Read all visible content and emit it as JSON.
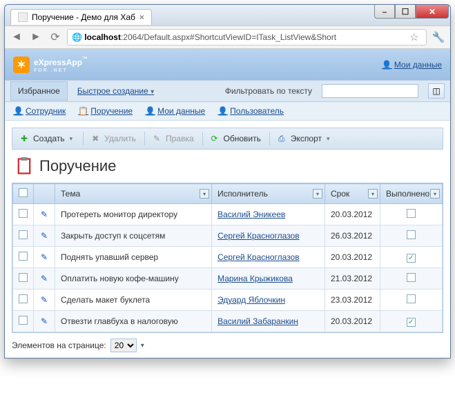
{
  "browser": {
    "tab_title": "Поручение - Демо для Хаб",
    "url_prefix": "localhost",
    "url_rest": ":2064/Default.aspx#ShortcutViewID=ITask_ListView&Short"
  },
  "header": {
    "logo_main": "eXpressApp",
    "logo_sub": "FOR .NET",
    "user_link": "Мои данные"
  },
  "menubar": {
    "favorites": "Избранное",
    "quick_create": "Быстрое создание",
    "filter_label": "Фильтровать по тексту"
  },
  "subnav": {
    "employee": "Сотрудник",
    "task": "Поручение",
    "mydata": "Мои данные",
    "user": "Пользователь"
  },
  "toolbar": {
    "create": "Создать",
    "delete": "Удалить",
    "edit": "Правка",
    "refresh": "Обновить",
    "export": "Экспорт"
  },
  "page": {
    "title": "Поручение"
  },
  "grid": {
    "columns": {
      "subject": "Тема",
      "assignee": "Исполнитель",
      "due": "Срок",
      "done": "Выполнено"
    },
    "rows": [
      {
        "subject": "Протереть монитор директору",
        "assignee": "Василий Эникеев",
        "due": "20.03.2012",
        "done": false
      },
      {
        "subject": "Закрыть доступ к соцсетям",
        "assignee": "Сергей Красноглазов",
        "due": "26.03.2012",
        "done": false
      },
      {
        "subject": "Поднять упавший сервер",
        "assignee": "Сергей Красноглазов",
        "due": "20.03.2012",
        "done": true
      },
      {
        "subject": "Оплатить новую кофе-машину",
        "assignee": "Марина Крыжикова",
        "due": "21.03.2012",
        "done": false
      },
      {
        "subject": "Сделать макет буклета",
        "assignee": "Эдуард Яблочкин",
        "due": "23.03.2012",
        "done": false
      },
      {
        "subject": "Отвезти главбуха в налоговую",
        "assignee": "Василий Забаранкин",
        "due": "20.03.2012",
        "done": true
      }
    ]
  },
  "pager": {
    "label": "Элементов на странице:",
    "size": "20"
  }
}
